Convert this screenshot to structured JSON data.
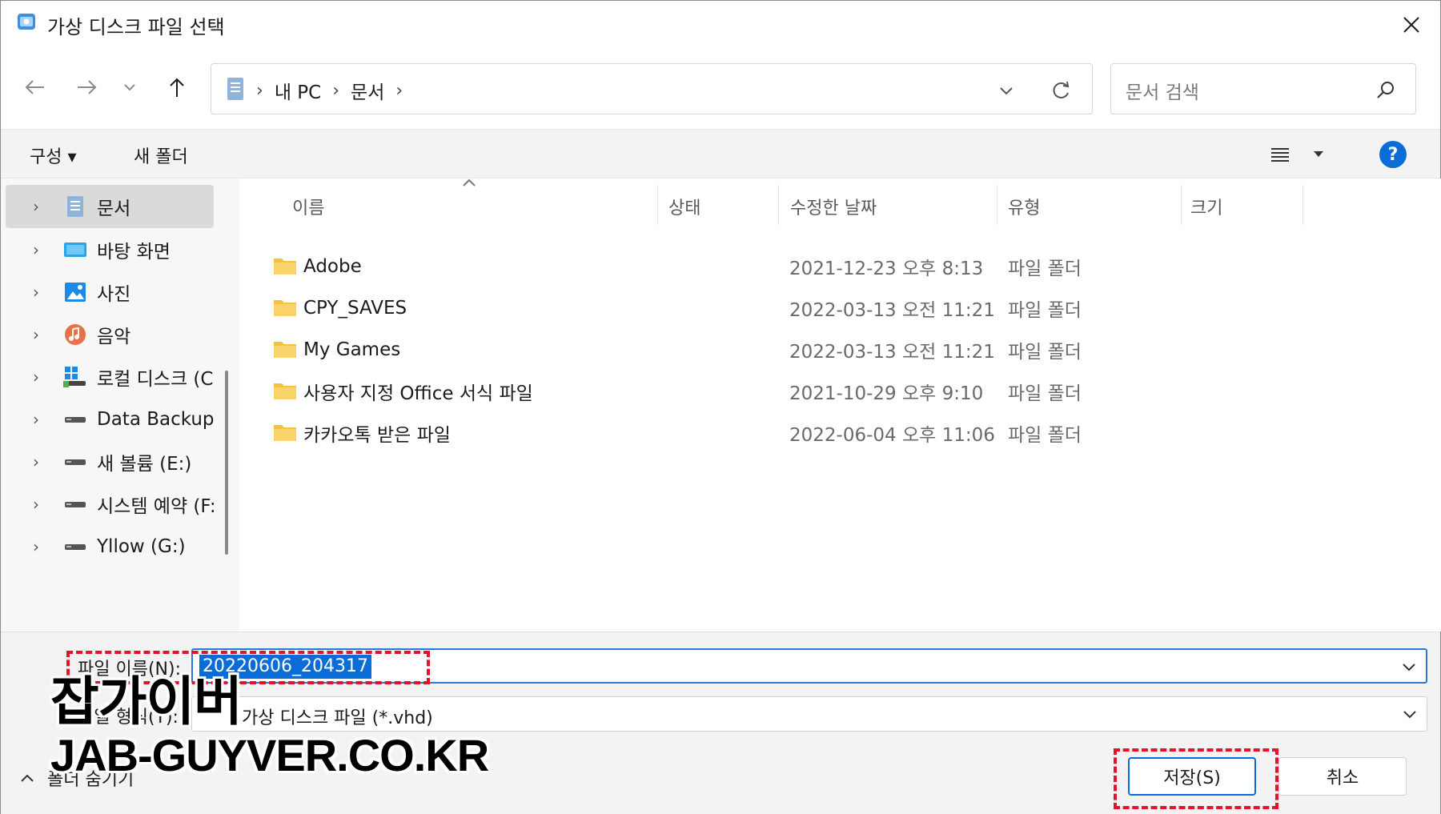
{
  "window": {
    "title": "가상 디스크 파일 선택"
  },
  "address": {
    "crumbs": [
      "내 PC",
      "문서"
    ],
    "sep": "›"
  },
  "search": {
    "placeholder": "문서 검색"
  },
  "toolbar": {
    "organize": "구성 ▾",
    "new_folder": "새 폴더",
    "help": "?"
  },
  "nav": {
    "items": [
      {
        "label": "문서",
        "icon": "documents-icon"
      },
      {
        "label": "바탕 화면",
        "icon": "desktop-icon"
      },
      {
        "label": "사진",
        "icon": "pictures-icon"
      },
      {
        "label": "음악",
        "icon": "music-icon"
      },
      {
        "label": "로컬 디스크 (C",
        "icon": "local-disk-icon"
      },
      {
        "label": "Data Backup (I",
        "icon": "drive-icon"
      },
      {
        "label": "새 볼륨 (E:)",
        "icon": "drive-icon"
      },
      {
        "label": "시스템 예약 (F:",
        "icon": "drive-icon"
      },
      {
        "label": "Yllow (G:)",
        "icon": "drive-icon"
      }
    ]
  },
  "columns": {
    "name": "이름",
    "status": "상태",
    "date": "수정한 날짜",
    "type": "유형",
    "size": "크기"
  },
  "files": [
    {
      "name": "Adobe",
      "date": "2021-12-23 오후 8:13",
      "type": "파일 폴더"
    },
    {
      "name": "CPY_SAVES",
      "date": "2022-03-13 오전 11:21",
      "type": "파일 폴더"
    },
    {
      "name": "My Games",
      "date": "2022-03-13 오전 11:21",
      "type": "파일 폴더"
    },
    {
      "name": "사용자 지정 Office 서식 파일",
      "date": "2021-10-29 오후 9:10",
      "type": "파일 폴더"
    },
    {
      "name": "카카오톡 받은 파일",
      "date": "2022-06-04 오후 11:06",
      "type": "파일 폴더"
    }
  ],
  "filename": {
    "label": "파일 이름(N):",
    "value": "20220606_204317"
  },
  "filetype": {
    "label": "파일 형식(T):",
    "value": "가상 디스크 파일 (*.vhd)"
  },
  "buttons": {
    "hide_folders": "폴더 숨기기",
    "save": "저장(S)",
    "cancel": "취소"
  },
  "watermark": {
    "line1": "잡가이버",
    "line2": "JAB-GUYVER.CO.KR"
  },
  "colors": {
    "accent": "#0a6cd6",
    "highlight": "#e4122a",
    "folder": "#f5c242"
  }
}
